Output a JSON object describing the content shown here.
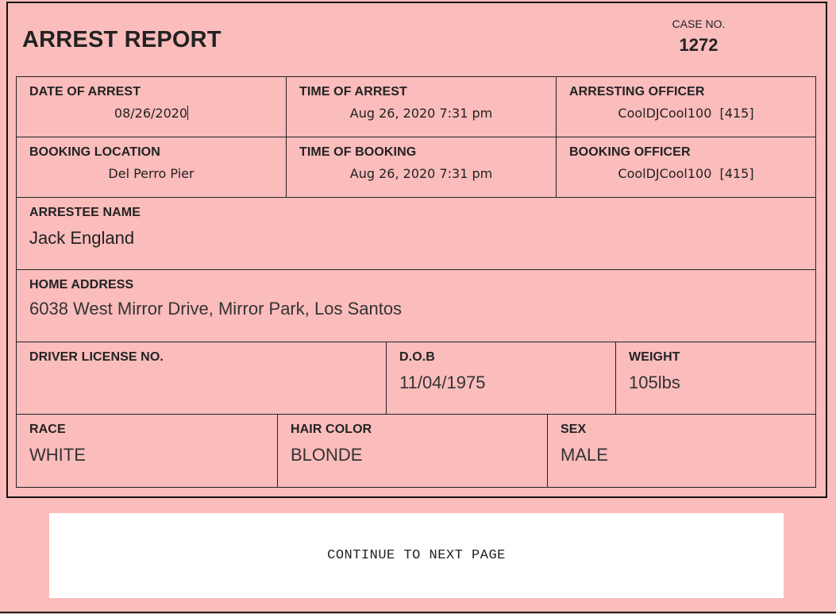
{
  "report": {
    "title": "ARREST REPORT",
    "case_label": "CASE NO.",
    "case_number": "1272"
  },
  "row1": {
    "date_of_arrest_label": "DATE OF ARREST",
    "date_of_arrest_value": "08/26/2020",
    "time_of_arrest_label": "TIME OF ARREST",
    "time_of_arrest_value": "Aug 26, 2020 7:31 pm",
    "arresting_officer_label": "ARRESTING OFFICER",
    "arresting_officer_value": "CoolDJCool100  [415]"
  },
  "row2": {
    "booking_location_label": "BOOKING LOCATION",
    "booking_location_value": "Del Perro Pier",
    "time_of_booking_label": "TIME OF BOOKING",
    "time_of_booking_value": "Aug 26, 2020 7:31 pm",
    "booking_officer_label": "BOOKING OFFICER",
    "booking_officer_value": "CoolDJCool100  [415]"
  },
  "arrestee": {
    "name_label": "ARRESTEE NAME",
    "name_value": "Jack England",
    "address_label": "HOME ADDRESS",
    "address_value": "6038 West Mirror Drive, Mirror Park, Los Santos"
  },
  "details": {
    "license_label": "DRIVER LICENSE NO.",
    "license_value": "",
    "dob_label": "D.O.B",
    "dob_value": "11/04/1975",
    "weight_label": "WEIGHT",
    "weight_value": "105lbs",
    "race_label": "RACE",
    "race_value": "WHITE",
    "hair_label": "HAIR COLOR",
    "hair_value": "BLONDE",
    "sex_label": "SEX",
    "sex_value": "MALE"
  },
  "actions": {
    "continue_label": "CONTINUE TO NEXT PAGE"
  },
  "colors": {
    "background": "#fbbcbc",
    "border": "#222222",
    "button_bg": "#ffffff"
  }
}
